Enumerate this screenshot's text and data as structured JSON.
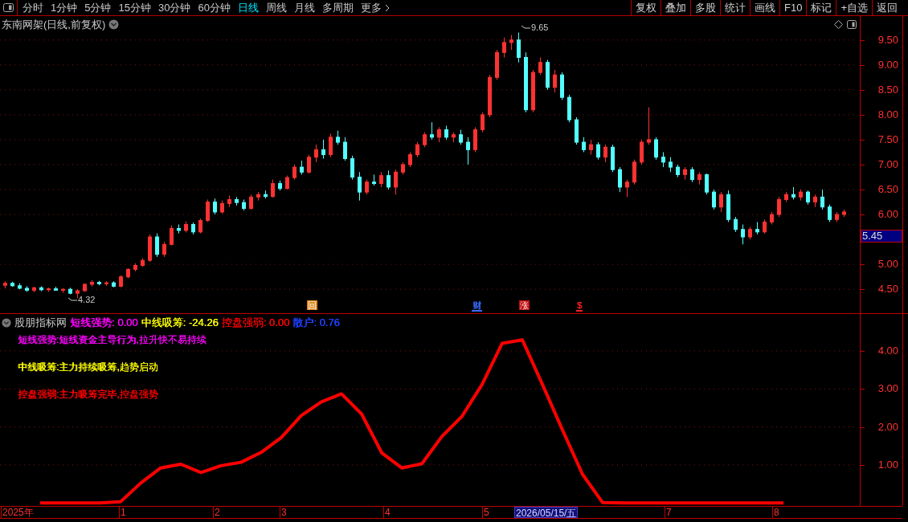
{
  "toolbar": {
    "periods": [
      {
        "label": "分时",
        "selected": false
      },
      {
        "label": "1分钟",
        "selected": false
      },
      {
        "label": "5分钟",
        "selected": false
      },
      {
        "label": "15分钟",
        "selected": false
      },
      {
        "label": "30分钟",
        "selected": false
      },
      {
        "label": "60分钟",
        "selected": false
      },
      {
        "label": "日线",
        "selected": true
      },
      {
        "label": "周线",
        "selected": false
      },
      {
        "label": "月线",
        "selected": false
      },
      {
        "label": "多周期",
        "selected": false
      },
      {
        "label": "更多",
        "selected": false
      }
    ],
    "actions": [
      "复权",
      "叠加",
      "多股",
      "统计",
      "画线",
      "F10",
      "标记",
      "+自选",
      "返回"
    ]
  },
  "price_chart": {
    "title": "东南网架(日线,前复权)",
    "high_label": "9.65",
    "low_label": "4.32",
    "current_price": "5.45",
    "events": [
      {
        "text": "回",
        "kind": "box",
        "color": "#e08a1e"
      },
      {
        "text": "财",
        "kind": "text",
        "color": "#3a6cff"
      },
      {
        "text": "涨",
        "kind": "filled",
        "color": "#c01010"
      },
      {
        "text": "$",
        "kind": "text",
        "color": "#ff2020"
      }
    ],
    "chart_data": {
      "type": "candlestick",
      "grid": true,
      "ylim": [
        4.02,
        9.98
      ],
      "yticks": [
        {
          "value": 9.5,
          "label": "9.50"
        },
        {
          "value": 9,
          "label": "9.00"
        },
        {
          "value": 8.5,
          "label": "8.50"
        },
        {
          "value": 8,
          "label": "8.00"
        },
        {
          "value": 7.5,
          "label": "7.50"
        },
        {
          "value": 7,
          "label": "7.00"
        },
        {
          "value": 6.5,
          "label": "6.50"
        },
        {
          "value": 6,
          "label": "6.00"
        },
        {
          "value": 5,
          "label": "5.00"
        },
        {
          "value": 4.5,
          "label": "4.50"
        }
      ],
      "categories": [
        null,
        null,
        null,
        null,
        null,
        null,
        null,
        null,
        null,
        null,
        null,
        null,
        null,
        null,
        null,
        null,
        null,
        null,
        null,
        null,
        null,
        null,
        null,
        null,
        null,
        null,
        null,
        null,
        null,
        null,
        null,
        null,
        null,
        null,
        null,
        null,
        null,
        null,
        null,
        null,
        null,
        null,
        null,
        null,
        null,
        null,
        null,
        null,
        null,
        null,
        null,
        null,
        null,
        null,
        null,
        null,
        null,
        null,
        null,
        null,
        null,
        null,
        null,
        null,
        null,
        null,
        null,
        null,
        null,
        null,
        null,
        null,
        null,
        null,
        null,
        null,
        null,
        null,
        null,
        null,
        null,
        null,
        null,
        null,
        null,
        null,
        null,
        null,
        null,
        null,
        null,
        null,
        null,
        null,
        null,
        null,
        null,
        null,
        null,
        null,
        null,
        null,
        null,
        null,
        null,
        null,
        null,
        null,
        null,
        null,
        null,
        null,
        null,
        null,
        null,
        null,
        null
      ],
      "ohlc": [
        [
          4.58,
          4.66,
          4.52,
          4.62
        ],
        [
          4.62,
          4.65,
          4.55,
          4.57
        ],
        [
          4.57,
          4.62,
          4.5,
          4.52
        ],
        [
          4.52,
          4.56,
          4.45,
          4.48
        ],
        [
          4.48,
          4.55,
          4.44,
          4.53
        ],
        [
          4.53,
          4.56,
          4.46,
          4.49
        ],
        [
          4.49,
          4.53,
          4.45,
          4.51
        ],
        [
          4.51,
          4.55,
          4.47,
          4.48
        ],
        [
          4.48,
          4.52,
          4.43,
          4.5
        ],
        [
          4.5,
          4.53,
          4.4,
          4.42
        ],
        [
          4.42,
          4.5,
          4.32,
          4.47
        ],
        [
          4.47,
          4.62,
          4.45,
          4.6
        ],
        [
          4.6,
          4.68,
          4.56,
          4.64
        ],
        [
          4.64,
          4.67,
          4.58,
          4.61
        ],
        [
          4.61,
          4.66,
          4.57,
          4.63
        ],
        [
          4.63,
          4.66,
          4.54,
          4.56
        ],
        [
          4.56,
          4.78,
          4.54,
          4.75
        ],
        [
          4.75,
          4.92,
          4.72,
          4.9
        ],
        [
          4.9,
          5.02,
          4.86,
          4.98
        ],
        [
          4.98,
          5.12,
          4.95,
          5.08
        ],
        [
          5.08,
          5.6,
          5.05,
          5.55
        ],
        [
          5.55,
          5.62,
          5.15,
          5.2
        ],
        [
          5.2,
          5.45,
          5.15,
          5.4
        ],
        [
          5.4,
          5.78,
          5.38,
          5.72
        ],
        [
          5.72,
          5.8,
          5.62,
          5.68
        ],
        [
          5.68,
          5.86,
          5.64,
          5.8
        ],
        [
          5.8,
          5.84,
          5.6,
          5.65
        ],
        [
          5.65,
          5.92,
          5.62,
          5.88
        ],
        [
          5.88,
          6.3,
          5.85,
          6.25
        ],
        [
          6.25,
          6.32,
          6,
          6.05
        ],
        [
          6.05,
          6.28,
          6.02,
          6.22
        ],
        [
          6.22,
          6.38,
          6.15,
          6.3
        ],
        [
          6.3,
          6.35,
          6.18,
          6.24
        ],
        [
          6.24,
          6.3,
          6.08,
          6.12
        ],
        [
          6.12,
          6.4,
          6.1,
          6.35
        ],
        [
          6.35,
          6.45,
          6.28,
          6.4
        ],
        [
          6.4,
          6.48,
          6.32,
          6.36
        ],
        [
          6.36,
          6.7,
          6.34,
          6.62
        ],
        [
          6.62,
          6.68,
          6.48,
          6.52
        ],
        [
          6.52,
          6.78,
          6.5,
          6.74
        ],
        [
          6.74,
          7,
          6.7,
          6.95
        ],
        [
          6.95,
          7.08,
          6.8,
          6.85
        ],
        [
          6.85,
          7.2,
          6.82,
          7.15
        ],
        [
          7.15,
          7.4,
          7.05,
          7.3
        ],
        [
          7.3,
          7.5,
          7.12,
          7.2
        ],
        [
          7.2,
          7.62,
          7.15,
          7.55
        ],
        [
          7.55,
          7.68,
          7.4,
          7.45
        ],
        [
          7.45,
          7.55,
          7.08,
          7.12
        ],
        [
          7.12,
          7.18,
          6.7,
          6.75
        ],
        [
          6.75,
          6.85,
          6.28,
          6.45
        ],
        [
          6.45,
          6.7,
          6.4,
          6.65
        ],
        [
          6.65,
          6.8,
          6.58,
          6.62
        ],
        [
          6.62,
          6.85,
          6.55,
          6.78
        ],
        [
          6.78,
          6.88,
          6.5,
          6.55
        ],
        [
          6.55,
          6.9,
          6.4,
          6.85
        ],
        [
          6.85,
          7.05,
          6.8,
          7
        ],
        [
          7,
          7.25,
          6.95,
          7.2
        ],
        [
          7.2,
          7.45,
          7.15,
          7.4
        ],
        [
          7.4,
          7.65,
          7.35,
          7.6
        ],
        [
          7.6,
          7.85,
          7.5,
          7.55
        ],
        [
          7.55,
          7.75,
          7.45,
          7.7
        ],
        [
          7.7,
          7.78,
          7.5,
          7.55
        ],
        [
          7.55,
          7.65,
          7.45,
          7.6
        ],
        [
          7.6,
          7.7,
          7.4,
          7.45
        ],
        [
          7.45,
          7.55,
          7,
          7.3
        ],
        [
          7.3,
          7.75,
          7.25,
          7.7
        ],
        [
          7.7,
          8.05,
          7.65,
          8
        ],
        [
          8,
          8.8,
          7.95,
          8.75
        ],
        [
          8.75,
          9.3,
          8.7,
          9.25
        ],
        [
          9.25,
          9.55,
          9.15,
          9.45
        ],
        [
          9.45,
          9.6,
          9.3,
          9.5
        ],
        [
          9.5,
          9.65,
          9.05,
          9.15
        ],
        [
          9.15,
          9.25,
          8.05,
          8.1
        ],
        [
          8.1,
          8.9,
          8.05,
          8.85
        ],
        [
          8.85,
          9.15,
          8.8,
          9.05
        ],
        [
          9.05,
          9.1,
          8.5,
          8.55
        ],
        [
          8.55,
          8.9,
          8.45,
          8.8
        ],
        [
          8.8,
          8.85,
          8.3,
          8.35
        ],
        [
          8.35,
          8.4,
          7.85,
          7.9
        ],
        [
          7.9,
          7.95,
          7.4,
          7.45
        ],
        [
          7.45,
          7.55,
          7.25,
          7.3
        ],
        [
          7.3,
          7.5,
          7.2,
          7.4
        ],
        [
          7.4,
          7.45,
          7.1,
          7.15
        ],
        [
          7.15,
          7.4,
          7.05,
          7.35
        ],
        [
          7.35,
          7.4,
          6.85,
          6.9
        ],
        [
          6.9,
          6.95,
          6.45,
          6.55
        ],
        [
          6.55,
          6.7,
          6.35,
          6.65
        ],
        [
          6.65,
          7.1,
          6.6,
          7.05
        ],
        [
          7.05,
          7.5,
          7,
          7.45
        ],
        [
          7.45,
          8.15,
          7.4,
          7.5
        ],
        [
          7.5,
          7.55,
          7.1,
          7.15
        ],
        [
          7.15,
          7.25,
          6.95,
          7.05
        ],
        [
          7.05,
          7.15,
          6.85,
          6.95
        ],
        [
          6.95,
          7,
          6.75,
          6.8
        ],
        [
          6.8,
          6.95,
          6.7,
          6.9
        ],
        [
          6.9,
          6.95,
          6.65,
          6.7
        ],
        [
          6.7,
          6.85,
          6.6,
          6.8
        ],
        [
          6.8,
          6.82,
          6.4,
          6.45
        ],
        [
          6.45,
          6.5,
          6.1,
          6.15
        ],
        [
          6.15,
          6.45,
          6.05,
          6.4
        ],
        [
          6.4,
          6.48,
          5.85,
          5.9
        ],
        [
          5.9,
          5.95,
          5.65,
          5.7
        ],
        [
          5.7,
          5.8,
          5.4,
          5.55
        ],
        [
          5.55,
          5.75,
          5.5,
          5.7
        ],
        [
          5.7,
          5.85,
          5.6,
          5.65
        ],
        [
          5.65,
          5.9,
          5.62,
          5.85
        ],
        [
          5.85,
          6.05,
          5.8,
          6
        ],
        [
          6,
          6.35,
          5.95,
          6.3
        ],
        [
          6.3,
          6.45,
          6.25,
          6.4
        ],
        [
          6.4,
          6.55,
          6.3,
          6.35
        ],
        [
          6.35,
          6.5,
          6.28,
          6.45
        ],
        [
          6.45,
          6.48,
          6.2,
          6.25
        ],
        [
          6.25,
          6.4,
          6.15,
          6.35
        ],
        [
          6.35,
          6.5,
          6.1,
          6.15
        ],
        [
          6.15,
          6.2,
          5.85,
          5.9
        ],
        [
          5.9,
          6.05,
          5.85,
          6
        ],
        [
          6,
          6.1,
          5.95,
          6.05
        ]
      ]
    }
  },
  "indicator": {
    "name": "股朋指标网",
    "readings": [
      {
        "text": "短线强势: 0.00",
        "color": "#ff00ff"
      },
      {
        "text": "中线吸筹: -24.26",
        "color": "#ffff00"
      },
      {
        "text": "控盘强弱: 0.00",
        "color": "#ff0000"
      },
      {
        "text": "散户: 0.76",
        "color": "#2040ff"
      }
    ],
    "notes": [
      {
        "text": "短线强势:短线资金主导行为,拉升快不易持续",
        "color": "#ff00ff"
      },
      {
        "text": "中线吸筹:主力持续吸筹,趋势启动",
        "color": "#ffff00"
      },
      {
        "text": "控盘强弱:主力吸筹完毕,控盘强势",
        "color": "#ff0000"
      }
    ],
    "chart_data": {
      "type": "line",
      "grid": true,
      "ylim": [
        -0.1,
        4.97
      ],
      "yticks": [
        {
          "value": 4,
          "label": "4.00"
        },
        {
          "value": 3,
          "label": "3.00"
        },
        {
          "value": 2,
          "label": "2.00"
        },
        {
          "value": 1,
          "label": "1.00"
        }
      ],
      "categories": [
        null,
        null,
        null,
        null,
        null,
        null,
        null,
        null,
        null,
        null,
        null,
        null,
        null,
        null,
        null,
        null,
        null,
        null,
        null,
        null,
        null,
        null,
        null,
        null,
        null,
        null,
        null,
        null,
        null,
        null,
        null,
        null,
        null,
        null,
        null,
        null,
        null,
        null
      ],
      "series": [
        {
          "color": "#ff0000",
          "values": [
            0,
            0,
            0,
            0,
            0.03,
            0.52,
            0.92,
            1.02,
            0.8,
            0.98,
            1.07,
            1.33,
            1.72,
            2.3,
            2.66,
            2.87,
            2.34,
            1.32,
            0.92,
            1.03,
            1.75,
            2.28,
            3.12,
            4.2,
            4.29,
            3.12,
            1.92,
            0.75,
            0.01,
            0,
            0,
            0,
            0,
            0,
            0,
            0,
            0,
            0
          ]
        }
      ]
    }
  },
  "date_axis": [
    {
      "label": "2025年",
      "selected": false
    },
    {
      "label": "1",
      "selected": false
    },
    {
      "label": "2",
      "selected": false
    },
    {
      "label": "3",
      "selected": false
    },
    {
      "label": "4",
      "selected": false
    },
    {
      "label": "5",
      "selected": false
    },
    {
      "label": "2026/05/15/五",
      "selected": true
    },
    {
      "label": "7",
      "selected": false
    },
    {
      "label": "8",
      "selected": false
    }
  ]
}
